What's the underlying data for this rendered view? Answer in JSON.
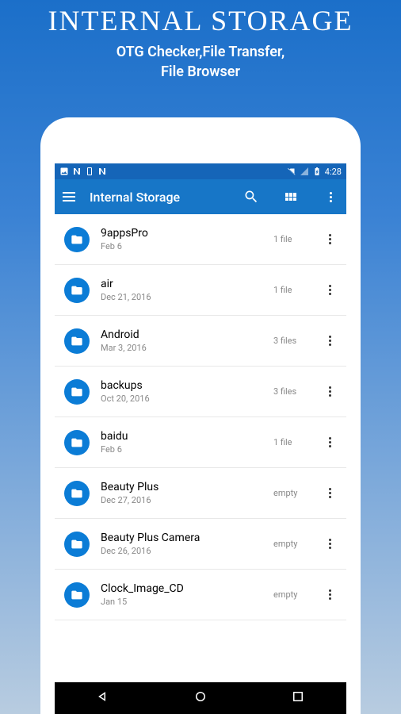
{
  "promo": {
    "title": "INTERNAL STORAGE",
    "subtitle1": "OTG Checker,File Transfer,",
    "subtitle2": "File Browser"
  },
  "statusBar": {
    "time": "4:28"
  },
  "appBar": {
    "title": "Internal Storage"
  },
  "items": [
    {
      "name": "9appsPro",
      "date": "Feb 6",
      "count": "1 file"
    },
    {
      "name": "air",
      "date": "Dec 21, 2016",
      "count": "1 file"
    },
    {
      "name": "Android",
      "date": "Mar 3, 2016",
      "count": "3 files"
    },
    {
      "name": "backups",
      "date": "Oct 20, 2016",
      "count": "3 files"
    },
    {
      "name": "baidu",
      "date": "Feb 6",
      "count": "1 file"
    },
    {
      "name": "Beauty Plus",
      "date": "Dec 27, 2016",
      "count": "empty"
    },
    {
      "name": "Beauty Plus Camera",
      "date": "Dec 26, 2016",
      "count": "empty"
    },
    {
      "name": "Clock_Image_CD",
      "date": "Jan 15",
      "count": "empty"
    }
  ]
}
